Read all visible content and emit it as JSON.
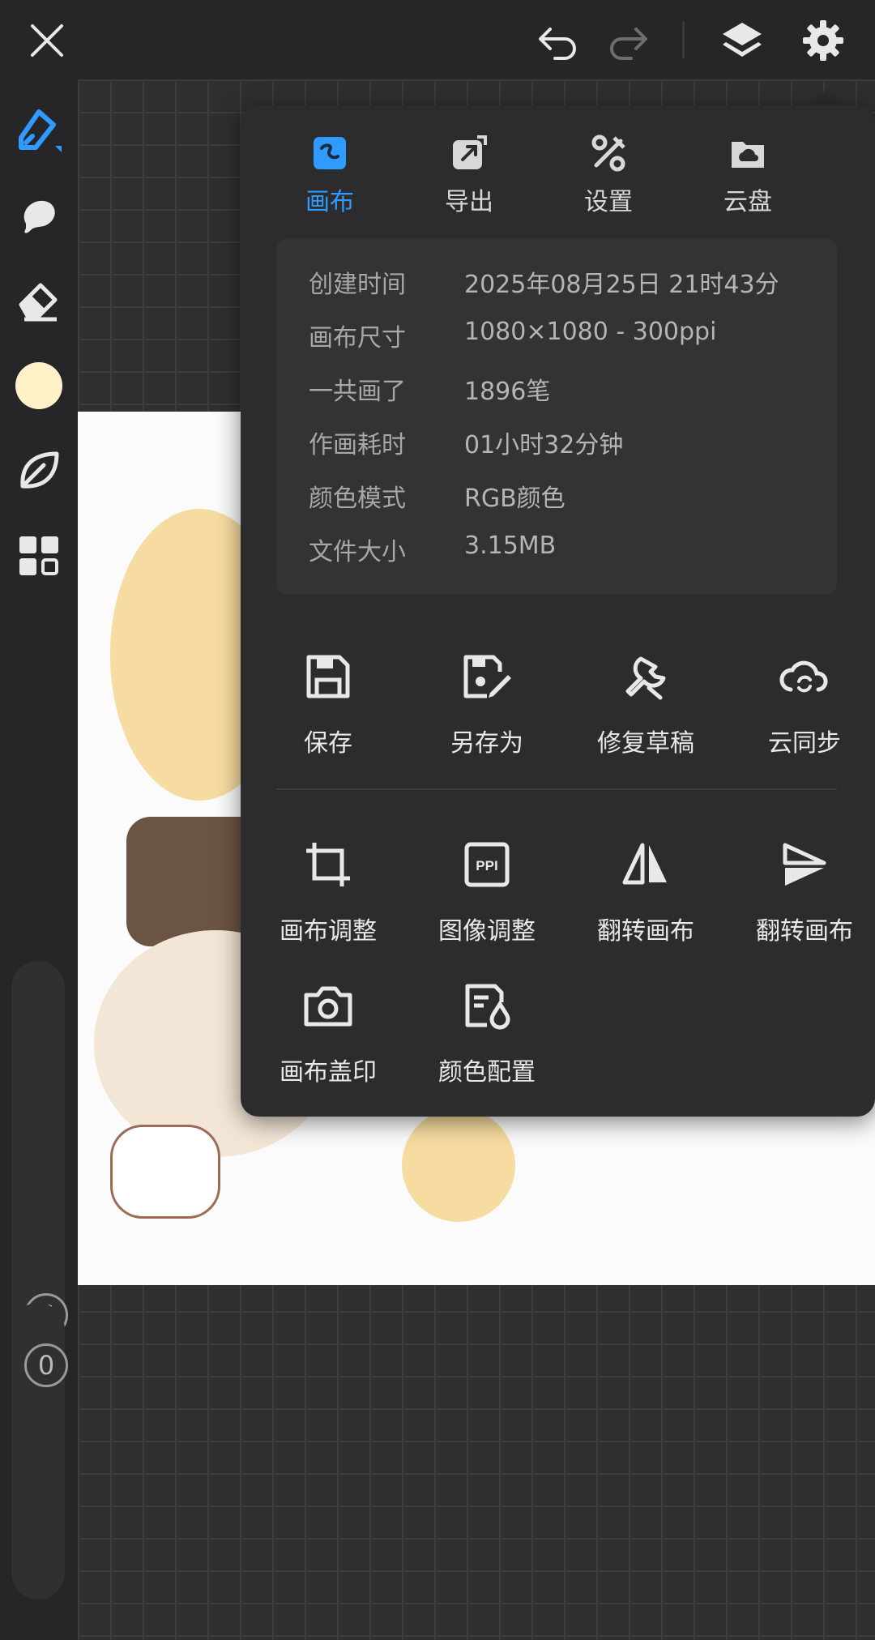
{
  "topbar": {
    "close_icon": "close-icon",
    "undo_icon": "undo-icon",
    "redo_icon": "redo-icon",
    "layers_icon": "layers-icon",
    "settings_icon": "gear-icon"
  },
  "left_toolbar": {
    "tools": [
      "brush-tool",
      "smudge-tool",
      "eraser-tool",
      "color-swatch",
      "leaf-tool",
      "grid-tool"
    ],
    "color": "#fff2c9",
    "size_slider_value": "S",
    "opacity_slider_value": "0"
  },
  "popup": {
    "tabs": [
      {
        "label": "画布",
        "icon": "canvas-icon",
        "active": true
      },
      {
        "label": "导出",
        "icon": "export-icon",
        "active": false
      },
      {
        "label": "设置",
        "icon": "tools-icon",
        "active": false
      },
      {
        "label": "云盘",
        "icon": "cloud-drive-icon",
        "active": false
      }
    ],
    "info": [
      {
        "key": "创建时间",
        "value": "2025年08月25日 21时43分"
      },
      {
        "key": "画布尺寸",
        "value": "1080×1080 - 300ppi"
      },
      {
        "key": "一共画了",
        "value": "1896笔"
      },
      {
        "key": "作画耗时",
        "value": "01小时32分钟"
      },
      {
        "key": "颜色模式",
        "value": "RGB颜色"
      },
      {
        "key": "文件大小",
        "value": "3.15MB"
      }
    ],
    "actions_row1": [
      {
        "label": "保存",
        "icon": "save-icon"
      },
      {
        "label": "另存为",
        "icon": "save-as-icon"
      },
      {
        "label": "修复草稿",
        "icon": "wrench-icon"
      },
      {
        "label": "云同步",
        "icon": "cloud-sync-icon"
      }
    ],
    "actions_row2": [
      {
        "label": "画布调整",
        "icon": "crop-icon"
      },
      {
        "label": "图像调整",
        "icon": "ppi-icon"
      },
      {
        "label": "翻转画布",
        "icon": "flip-horizontal-icon"
      },
      {
        "label": "翻转画布",
        "icon": "flip-vertical-icon"
      }
    ],
    "actions_row3": [
      {
        "label": "画布盖印",
        "icon": "camera-icon"
      },
      {
        "label": "颜色配置",
        "icon": "color-profile-icon"
      }
    ],
    "accent": "#2f9bff"
  }
}
